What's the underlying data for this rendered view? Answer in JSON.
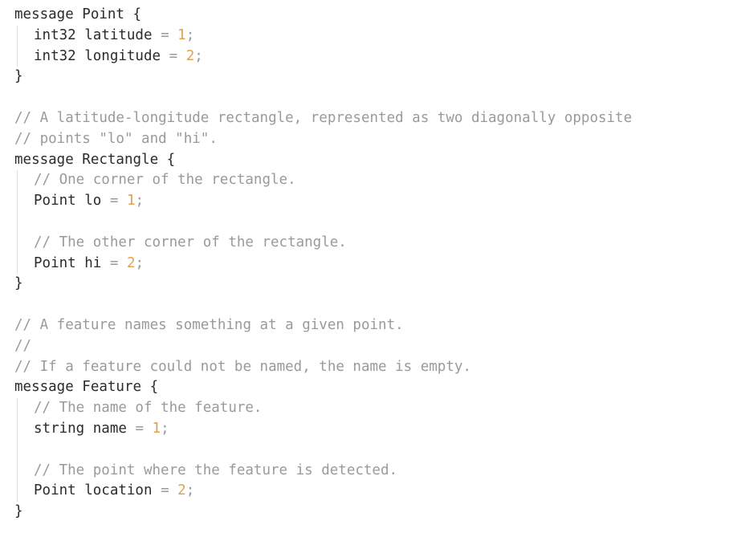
{
  "code": {
    "l01": "message Point {",
    "l02": {
      "name": "int32 latitude",
      "op": "=",
      "num": "1",
      "end": ";"
    },
    "l03": {
      "name": "int32 longitude",
      "op": "=",
      "num": "2",
      "end": ";"
    },
    "l04": "}",
    "l06": "// A latitude-longitude rectangle, represented as two diagonally opposite",
    "l07": "// points \"lo\" and \"hi\".",
    "l08": "message Rectangle {",
    "l09": "// One corner of the rectangle.",
    "l10": {
      "name": "Point lo",
      "op": "=",
      "num": "1",
      "end": ";"
    },
    "l12": "// The other corner of the rectangle.",
    "l13": {
      "name": "Point hi",
      "op": "=",
      "num": "2",
      "end": ";"
    },
    "l14": "}",
    "l16": "// A feature names something at a given point.",
    "l17": "//",
    "l18": "// If a feature could not be named, the name is empty.",
    "l19": "message Feature {",
    "l20": "// The name of the feature.",
    "l21": {
      "name": "string name",
      "op": "=",
      "num": "1",
      "end": ";"
    },
    "l23": "// The point where the feature is detected.",
    "l24": {
      "name": "Point location",
      "op": "=",
      "num": "2",
      "end": ";"
    },
    "l25": "}"
  },
  "colors": {
    "text": "#2b2b2b",
    "comment": "#9a9a9a",
    "number": "#e0a050",
    "guide": "#dedede"
  }
}
